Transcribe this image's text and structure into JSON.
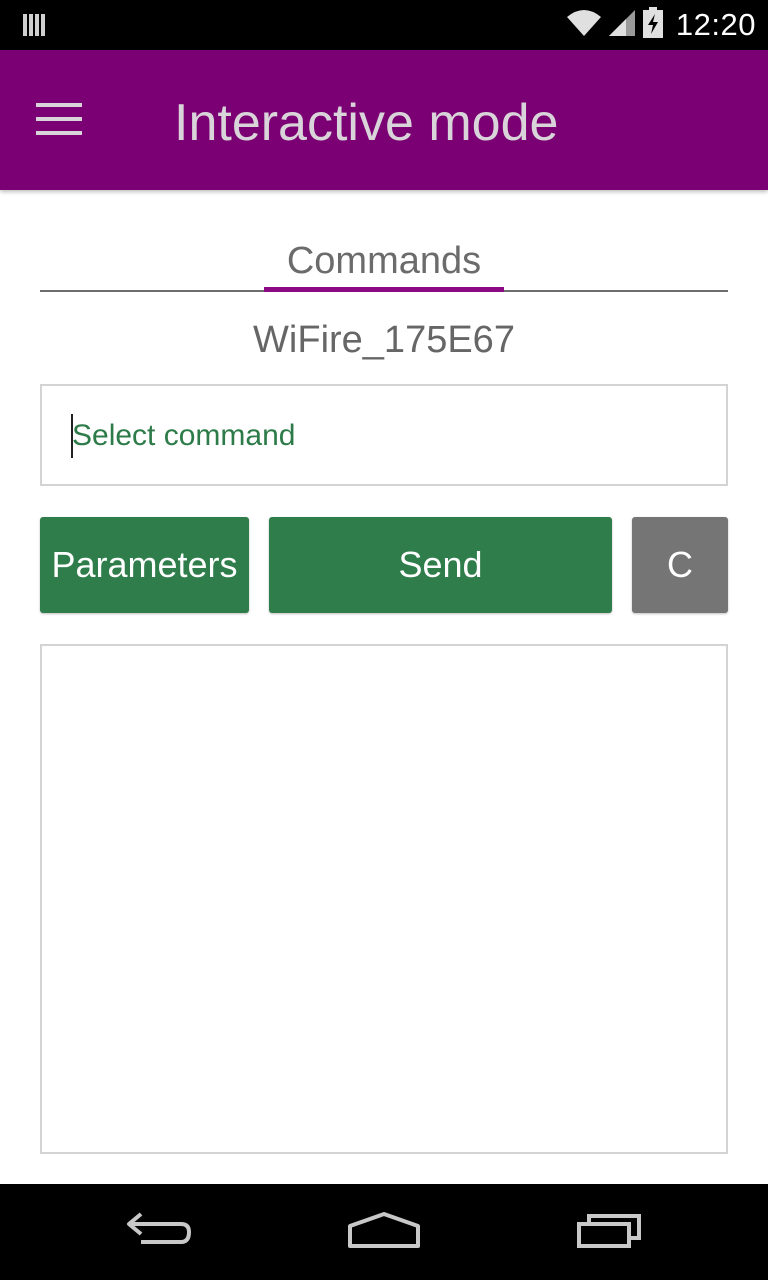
{
  "status_bar": {
    "time": "12:20",
    "icons": [
      "signal-bars-icon",
      "wifi-icon",
      "cell-signal-icon",
      "battery-charging-icon"
    ]
  },
  "app_bar": {
    "menu_icon": "hamburger-menu-icon",
    "title": "Interactive mode",
    "color": "#7b0073"
  },
  "tabs": [
    {
      "label": "Commands",
      "selected": true
    }
  ],
  "device": {
    "name": "WiFire_175E67"
  },
  "command_input": {
    "placeholder": "Select command",
    "value": ""
  },
  "buttons": {
    "parameters": "Parameters",
    "send": "Send",
    "clear": "C"
  },
  "output": {
    "text": ""
  },
  "nav_bar": {
    "icons": [
      "back-icon",
      "home-icon",
      "recents-icon"
    ]
  },
  "colors": {
    "accent_green": "#2e7d4a",
    "clear_gray": "#757575",
    "tab_indicator": "#8b0a84"
  }
}
